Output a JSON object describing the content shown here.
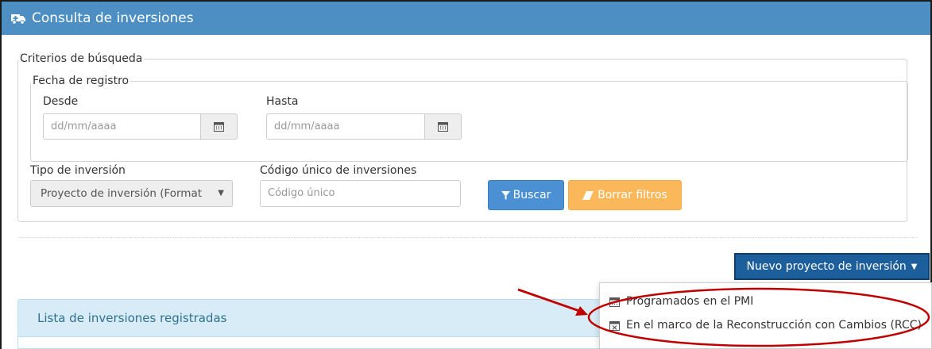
{
  "header": {
    "title": "Consulta de inversiones",
    "icon": "ambulance-icon"
  },
  "criteria": {
    "legend": "Criterios de búsqueda",
    "fecha_registro": {
      "legend": "Fecha de registro",
      "desde": {
        "label": "Desde",
        "placeholder": "dd/mm/aaaa"
      },
      "hasta": {
        "label": "Hasta",
        "placeholder": "dd/mm/aaaa"
      }
    },
    "tipo_inversion": {
      "label": "Tipo de inversión",
      "selected": "Proyecto de inversión (Format"
    },
    "codigo_unico": {
      "label": "Código único de inversiones",
      "placeholder": "Código único"
    },
    "buscar_label": "Buscar",
    "borrar_label": "Borrar filtros"
  },
  "nuevo_proyecto": {
    "label": "Nuevo proyecto de inversión",
    "menu": [
      {
        "label": "Programados en el PMI",
        "icon": "calendar-icon"
      },
      {
        "label": "En el marco de la Reconstrucción con Cambios (RCC)",
        "icon": "calendar-x-icon"
      }
    ]
  },
  "lista": {
    "title": "Lista de inversiones registradas"
  },
  "colors": {
    "header_bg": "#4d8ec3",
    "primary": "#4a90d2",
    "warning": "#fbb85a",
    "dark_button": "#1d5f9c",
    "annotation_red": "#c00000"
  }
}
